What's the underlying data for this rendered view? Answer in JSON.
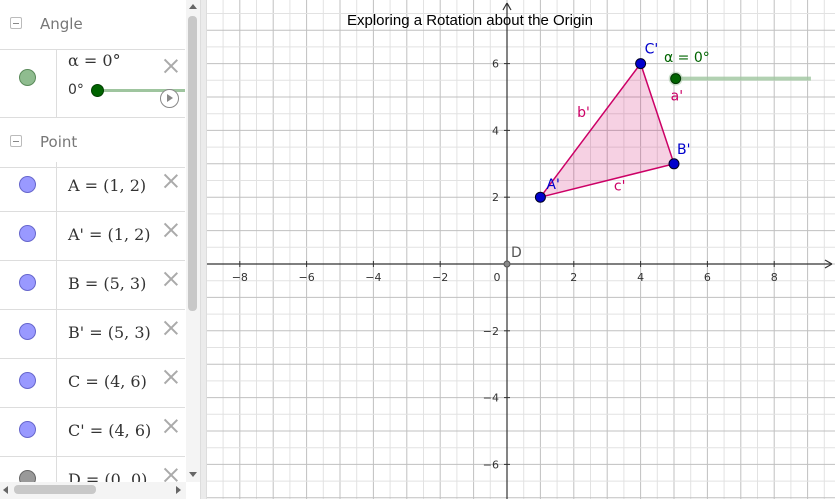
{
  "algebra": {
    "sections": {
      "angle": {
        "title": "Angle"
      },
      "point": {
        "title": "Point"
      }
    },
    "angle_item": {
      "expr": "α = 0°",
      "slider_min_label": "0°",
      "color": "#006400"
    },
    "points": [
      {
        "expr": "A = (1, 2)",
        "color": "#9999ff"
      },
      {
        "expr": "A' = (1, 2)",
        "color": "#9999ff"
      },
      {
        "expr": "B = (5, 3)",
        "color": "#9999ff"
      },
      {
        "expr": "B' = (5, 3)",
        "color": "#9999ff"
      },
      {
        "expr": "C = (4, 6)",
        "color": "#9999ff"
      },
      {
        "expr": "C' = (4, 6)",
        "color": "#9999ff"
      },
      {
        "expr": "D = (0, 0)",
        "color": "#999999"
      }
    ]
  },
  "graphics": {
    "title": "Exploring a Rotation about the Origin",
    "x_ticks": [
      "−8",
      "−6",
      "−4",
      "−2",
      "0",
      "2",
      "4",
      "6",
      "8"
    ],
    "y_ticks": [
      "6",
      "4",
      "2",
      "−2",
      "−4",
      "−6"
    ],
    "x_tick_values": [
      -8,
      -6,
      -4,
      -2,
      0,
      2,
      4,
      6,
      8
    ],
    "y_tick_values": [
      6,
      4,
      2,
      -2,
      -4,
      -6
    ],
    "triangle": {
      "fill": "#cc0066",
      "points": [
        [
          1,
          2
        ],
        [
          5,
          3
        ],
        [
          4,
          6
        ]
      ]
    },
    "vertex_labels": {
      "A": "A'",
      "B": "B'",
      "C": "C'",
      "D": "D"
    },
    "segment_labels": {
      "a": "a'",
      "b": "b'",
      "c": "c'"
    },
    "slider_label": "α = 0°",
    "colors": {
      "point": "#0000cc",
      "segment": "#cc0066",
      "slider": "#006400",
      "grid": "#c0c0c0"
    }
  }
}
